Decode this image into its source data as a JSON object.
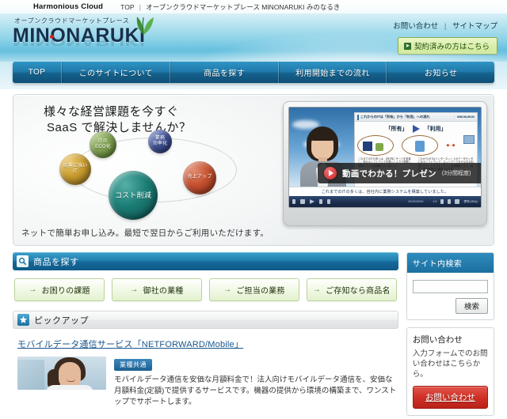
{
  "topbar": {
    "brand": "Harmonious Cloud",
    "crumb_home": "TOP",
    "separator": "|",
    "crumb_current": "オープンクラウドマーケットプレース MINONARUKI みのなるき"
  },
  "header": {
    "logo_tagline": "オープンクラウドマーケットプレース",
    "logo_text": "MINONARUKI",
    "links": {
      "contact": "お問い合わせ",
      "divider": "|",
      "sitemap": "サイトマップ"
    },
    "contract_button": "契約済みの方はこちら",
    "contract_icon": "arrow-right-icon"
  },
  "nav": {
    "items": [
      {
        "label": "TOP"
      },
      {
        "label": "このサイトについて"
      },
      {
        "label": "商品を探す"
      },
      {
        "label": "利用開始までの流れ"
      },
      {
        "label": "お知らせ"
      }
    ]
  },
  "hero": {
    "title_line1": "様々な経営課題を今すぐ",
    "title_line2": "SaaS で解決しませんか？",
    "subtitle": "ネットで簡単お申し込み。最短で翌日からご利用いただけます。",
    "bubbles": [
      {
        "label": "ITの\nECO化",
        "color": "#7d9e4e"
      },
      {
        "label": "業務\n効率化",
        "color": "#3d4f94"
      },
      {
        "label": "売上アップ",
        "color": "#c4502f"
      },
      {
        "label": "コスト削減",
        "color": "#1b7d76"
      },
      {
        "label": "災害に強い\nIT",
        "color": "#c79b2e"
      }
    ],
    "video": {
      "slide_header": "これからのITは「所有」から「利用」への流れ",
      "slide_logo": "MINONARUKI",
      "keyword_left": "「所有」",
      "keyword_right": "「利用」",
      "datacenter_label": "データセンタ",
      "note_left": "これまでのITの多くは、自社内にサーバを設置し、個々のソフトウェアを購入し人力で開発し、業務システムを構築していました。",
      "note_right": "これからのITはインターネット上のデータセンタにあるソフトウェア・ネットワークをそのまま利用するサービスです。すぐに利用開始できて、幅広い運用負荷から解放されます。",
      "caption": "これまでのITの多くは、自社内に業務システムを構築していました。",
      "time": "00:00:00/10",
      "rate": "1.0",
      "quality": "標準(480p)",
      "play_label": "動画でわかる！プレゼン",
      "play_duration": "(3分間程度)",
      "play_icon": "play-icon"
    }
  },
  "search_section": {
    "heading": "商品を探す",
    "heading_icon": "search-icon",
    "buttons": [
      {
        "label": "お困りの課題",
        "arrow": "→"
      },
      {
        "label": "御社の業種",
        "arrow": "→"
      },
      {
        "label": "ご担当の業務",
        "arrow": "→"
      },
      {
        "label": "ご存知なら商品名",
        "arrow": "→"
      }
    ]
  },
  "pickup_section": {
    "heading": "ピックアップ",
    "heading_icon": "star-icon",
    "link": "モバイルデータ通信サービス「NETFORWARD/Mobile」",
    "badge": "業種共通",
    "description": "モバイルデータ通信を安価な月額料金で！法人向けモバイルデータ通信を、安価な月額料金(定額)で提供するサービスです。機器の提供から環境の構築まで、ワンストップでサポートします。"
  },
  "sidebar": {
    "site_search": {
      "heading": "サイト内検索",
      "input_value": "",
      "input_placeholder": "",
      "button": "検索"
    },
    "contact": {
      "heading": "お問い合わせ",
      "text": "入力フォームでのお問い合わせはこちらから。",
      "button": "お問い合わせ"
    }
  }
}
